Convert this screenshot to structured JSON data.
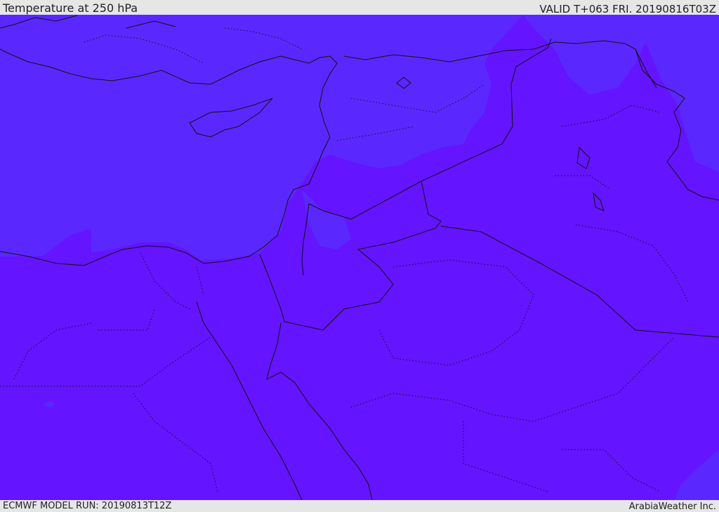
{
  "header": {
    "title": "Temperature at 250 hPa",
    "valid": "VALID T+063 FRI. 20190816T03Z"
  },
  "footer": {
    "model_run": "ECMWF MODEL RUN: 20190813T12Z",
    "credit": "ArabiaWeather Inc."
  },
  "map": {
    "field": "temperature",
    "level_hpa": 250,
    "colors": {
      "cooler_band": "#5a28ff",
      "warmer_band": "#6414ff",
      "border": "#111111",
      "coastline": "#111111"
    }
  }
}
